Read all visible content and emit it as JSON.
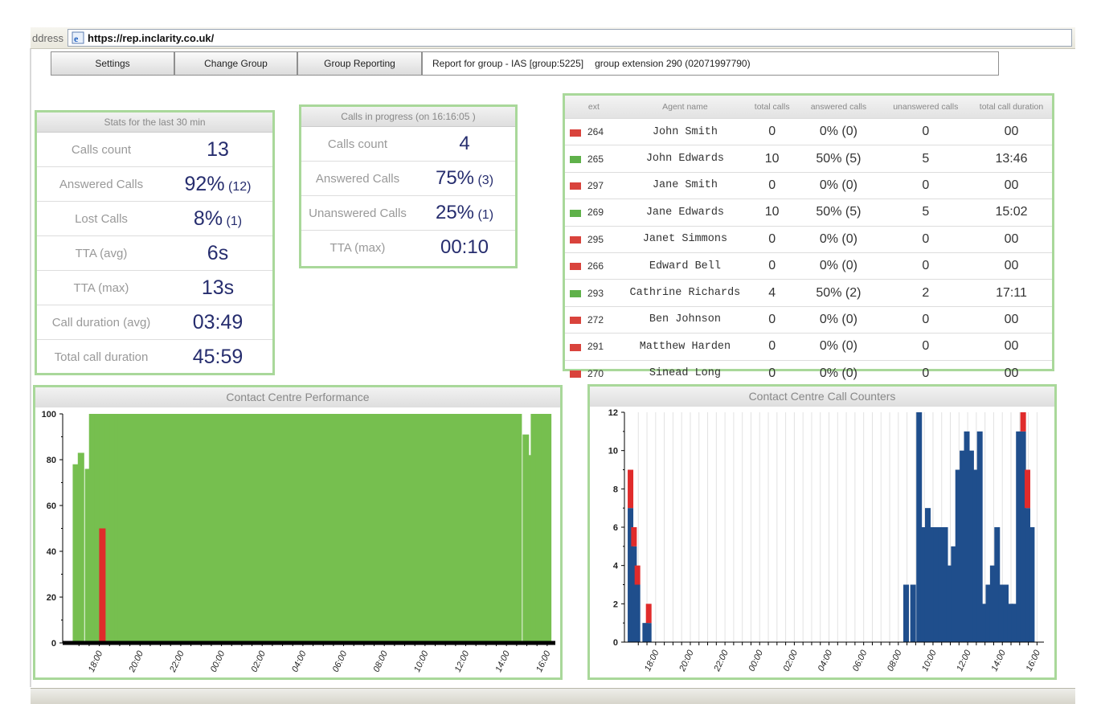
{
  "browser": {
    "address_label": "ddress",
    "url": "https://rep.inclarity.co.uk/"
  },
  "toolbar": {
    "settings_label": "Settings",
    "change_group_label": "Change Group",
    "group_reporting_label": "Group Reporting",
    "report_for_group": "Report for group - IAS [group:5225]",
    "group_extension": "group extension 290 (02071997790)"
  },
  "stats30": {
    "title": "Stats for the last 30 min",
    "rows": [
      {
        "label": "Calls count",
        "value": "13",
        "extra": ""
      },
      {
        "label": "Answered Calls",
        "value": "92%",
        "extra": "(12)"
      },
      {
        "label": "Lost Calls",
        "value": "8%",
        "extra": "(1)"
      },
      {
        "label": "TTA (avg)",
        "value": "6s",
        "extra": ""
      },
      {
        "label": "TTA (max)",
        "value": "13s",
        "extra": ""
      },
      {
        "label": "Call duration (avg)",
        "value": "03:49",
        "extra": ""
      },
      {
        "label": "Total call duration",
        "value": "45:59",
        "extra": ""
      }
    ]
  },
  "inprogress": {
    "title": "Calls in progress (on 16:16:05 )",
    "rows": [
      {
        "label": "Calls count",
        "value": "4",
        "extra": ""
      },
      {
        "label": "Answered Calls",
        "value": "75%",
        "extra": "(3)"
      },
      {
        "label": "Unanswered Calls",
        "value": "25%",
        "extra": "(1)"
      },
      {
        "label": "TTA (max)",
        "value": "00:10",
        "extra": ""
      }
    ]
  },
  "agents": {
    "headers": [
      "ext",
      "Agent name",
      "total calls",
      "answered calls",
      "unanswered calls",
      "total call duration"
    ],
    "rows": [
      {
        "flag": "red",
        "ext": "264",
        "name": "John Smith",
        "total": "0",
        "answered": "0% (0)",
        "unanswered": "0",
        "duration": "00"
      },
      {
        "flag": "green",
        "ext": "265",
        "name": "John Edwards",
        "total": "10",
        "answered": "50% (5)",
        "unanswered": "5",
        "duration": "13:46"
      },
      {
        "flag": "red",
        "ext": "297",
        "name": "Jane Smith",
        "total": "0",
        "answered": "0% (0)",
        "unanswered": "0",
        "duration": "00"
      },
      {
        "flag": "green",
        "ext": "269",
        "name": "Jane Edwards",
        "total": "10",
        "answered": "50% (5)",
        "unanswered": "5",
        "duration": "15:02"
      },
      {
        "flag": "red",
        "ext": "295",
        "name": "Janet Simmons",
        "total": "0",
        "answered": "0% (0)",
        "unanswered": "0",
        "duration": "00"
      },
      {
        "flag": "red",
        "ext": "266",
        "name": "Edward Bell",
        "total": "0",
        "answered": "0% (0)",
        "unanswered": "0",
        "duration": "00"
      },
      {
        "flag": "green",
        "ext": "293",
        "name": "Cathrine Richards",
        "total": "4",
        "answered": "50% (2)",
        "unanswered": "2",
        "duration": "17:11"
      },
      {
        "flag": "red",
        "ext": "272",
        "name": "Ben Johnson",
        "total": "0",
        "answered": "0% (0)",
        "unanswered": "0",
        "duration": "00"
      },
      {
        "flag": "red",
        "ext": "291",
        "name": "Matthew Harden",
        "total": "0",
        "answered": "0% (0)",
        "unanswered": "0",
        "duration": "00"
      },
      {
        "flag": "red",
        "ext": "270",
        "name": "Sinead Long",
        "total": "0",
        "answered": "0% (0)",
        "unanswered": "0",
        "duration": "00"
      }
    ]
  },
  "colors": {
    "panel_border": "#a9d89a",
    "value_text": "#262d6e",
    "answered": "#76bf4f",
    "lost": "#e02b2b",
    "calls": "#1f4e8c"
  },
  "chart_data": [
    {
      "type": "bar",
      "title": "Contact Centre Performance",
      "xlabel": "",
      "ylabel": "",
      "ylim": [
        0,
        100
      ],
      "y_ticks": [
        0,
        20,
        40,
        60,
        80,
        100
      ],
      "x_ticks": [
        "18:00",
        "20:00",
        "22:00",
        "00:00",
        "02:00",
        "04:00",
        "06:00",
        "08:00",
        "10:00",
        "12:00",
        "14:00",
        "16:00"
      ],
      "x_range_hours": [
        16.2,
        40.4
      ],
      "stacked": true,
      "series": [
        {
          "values": [
            [
              16.85,
              78
            ],
            [
              17.1,
              83
            ],
            [
              17.45,
              76
            ],
            [
              17.65,
              100
            ],
            [
              17.9,
              100
            ],
            [
              18.15,
              100
            ],
            [
              18.4,
              100
            ],
            [
              18.65,
              100
            ],
            [
              18.9,
              100
            ],
            [
              20.0,
              100
            ],
            [
              22.0,
              100
            ],
            [
              24.0,
              100
            ],
            [
              26.0,
              100
            ],
            [
              28.0,
              100
            ],
            [
              30.0,
              100
            ],
            [
              32.0,
              100
            ],
            [
              34.0,
              100
            ],
            [
              36.0,
              100
            ],
            [
              37.0,
              100
            ],
            [
              38.0,
              100
            ],
            [
              38.6,
              100
            ],
            [
              38.95,
              91
            ],
            [
              39.1,
              82
            ],
            [
              39.35,
              100
            ],
            [
              39.6,
              100
            ],
            [
              39.85,
              100
            ],
            [
              40.05,
              100
            ]
          ]
        },
        {
          "values": [
            [
              18.15,
              50
            ]
          ]
        }
      ]
    },
    {
      "type": "bar",
      "title": "Contact Centre Call Counters",
      "xlabel": "",
      "ylabel": "",
      "ylim": [
        0,
        12
      ],
      "y_ticks": [
        0,
        2,
        4,
        6,
        8,
        10,
        12
      ],
      "x_ticks": [
        "18:00",
        "20:00",
        "22:00",
        "00:00",
        "02:00",
        "04:00",
        "06:00",
        "08:00",
        "10:00",
        "12:00",
        "14:00",
        "16:00"
      ],
      "x_range_hours": [
        16.2,
        40.4
      ],
      "stacked": true,
      "series": [
        {
          "values": [
            [
              16.55,
              7
            ],
            [
              16.75,
              5
            ],
            [
              16.95,
              3
            ],
            [
              17.2,
              0
            ],
            [
              17.4,
              1
            ],
            [
              17.6,
              1
            ],
            [
              32.45,
              3
            ],
            [
              32.85,
              3
            ],
            [
              33.2,
              12
            ],
            [
              33.45,
              6
            ],
            [
              33.7,
              7
            ],
            [
              33.95,
              6
            ],
            [
              34.2,
              6
            ],
            [
              34.45,
              6
            ],
            [
              34.7,
              6
            ],
            [
              34.95,
              4
            ],
            [
              35.2,
              5
            ],
            [
              35.45,
              9
            ],
            [
              35.7,
              10
            ],
            [
              35.95,
              11
            ],
            [
              36.2,
              10
            ],
            [
              36.45,
              9
            ],
            [
              36.7,
              11
            ],
            [
              36.95,
              2
            ],
            [
              37.2,
              3
            ],
            [
              37.45,
              4
            ],
            [
              37.7,
              6
            ],
            [
              37.95,
              3
            ],
            [
              38.2,
              3
            ],
            [
              38.45,
              2
            ],
            [
              38.7,
              2
            ],
            [
              38.95,
              11
            ],
            [
              39.2,
              11
            ],
            [
              39.45,
              7
            ],
            [
              39.7,
              6
            ]
          ]
        },
        {
          "values": [
            [
              16.55,
              2
            ],
            [
              16.75,
              1
            ],
            [
              16.95,
              1
            ],
            [
              17.6,
              1
            ],
            [
              39.2,
              1
            ],
            [
              39.45,
              2
            ]
          ]
        }
      ]
    }
  ]
}
